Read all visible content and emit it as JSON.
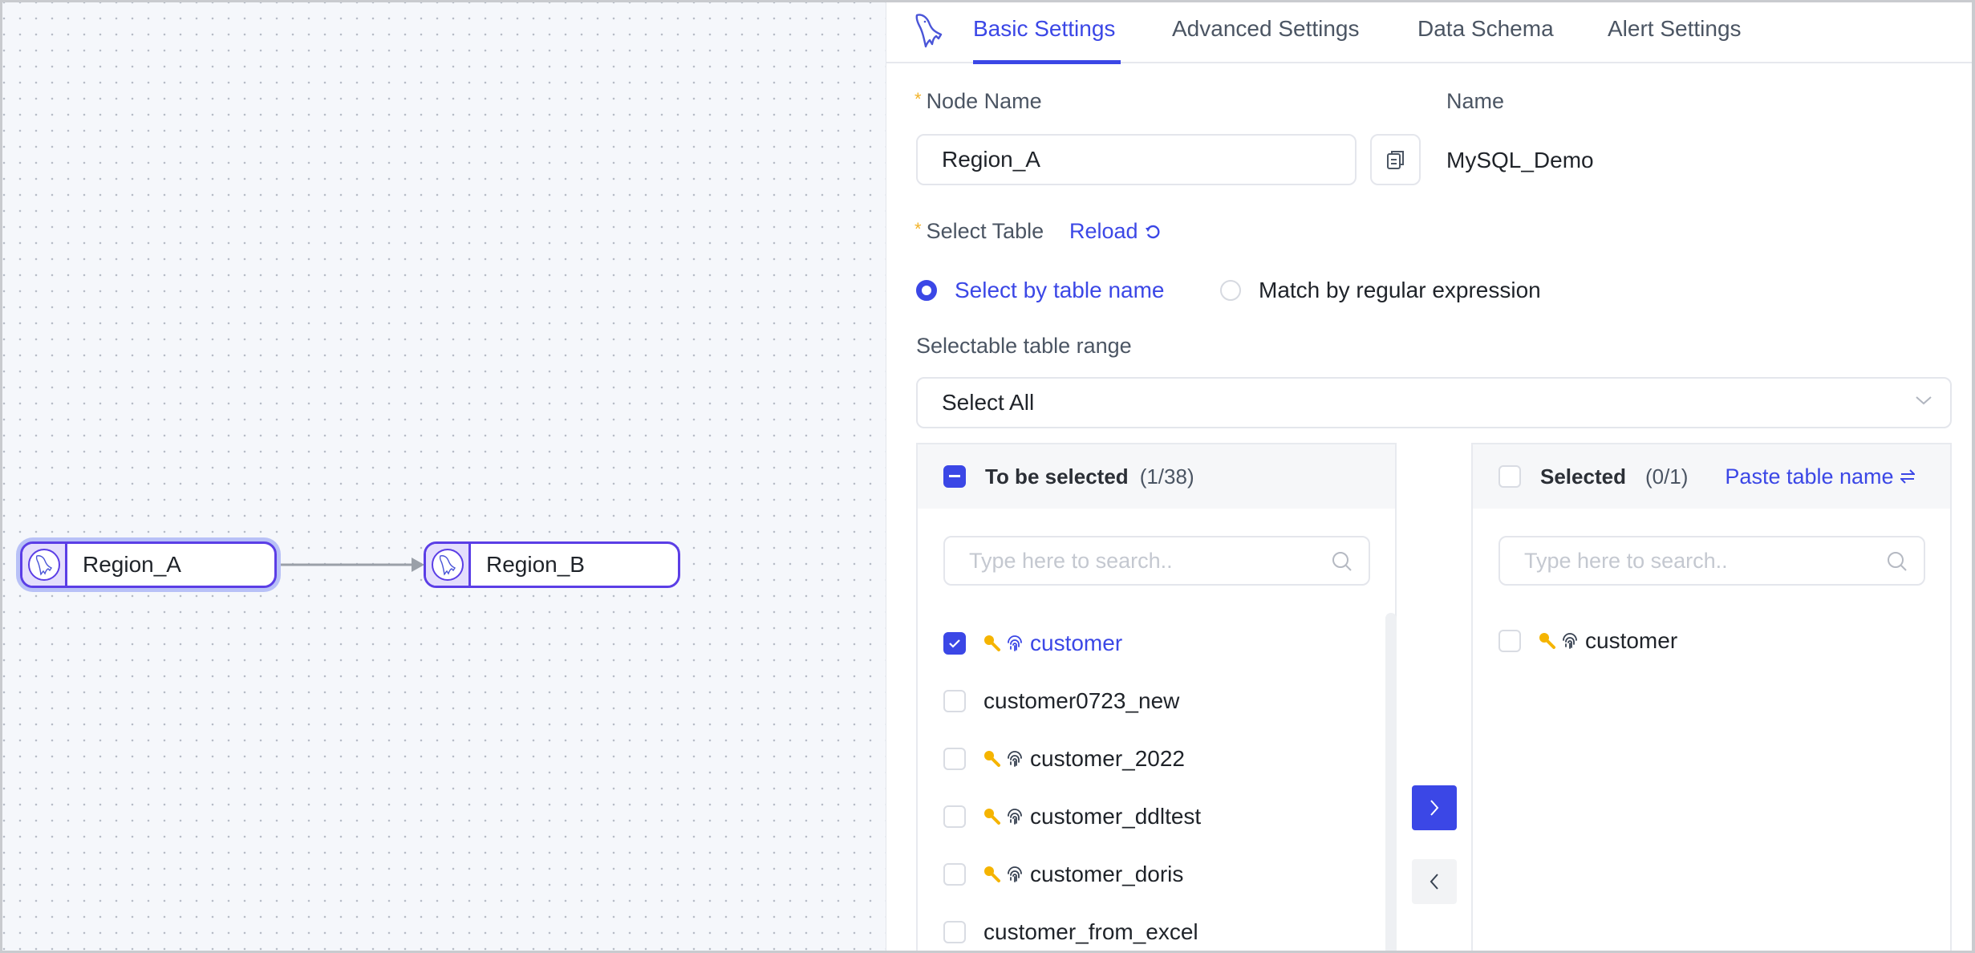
{
  "canvas": {
    "nodes": [
      {
        "label": "Region_A",
        "icon": "mysql-dolphin-icon",
        "selected": true
      },
      {
        "label": "Region_B",
        "icon": "mysql-dolphin-icon",
        "selected": false
      }
    ],
    "edges": [
      {
        "from": "Region_A",
        "to": "Region_B"
      }
    ]
  },
  "panel": {
    "logo_icon": "mysql-dolphin-icon",
    "tabs": [
      {
        "label": "Basic Settings",
        "active": true
      },
      {
        "label": "Advanced Settings",
        "active": false
      },
      {
        "label": "Data Schema",
        "active": false
      },
      {
        "label": "Alert Settings",
        "active": false
      }
    ],
    "node_name": {
      "label": "Node Name",
      "required_mark": "*",
      "value": "Region_A",
      "copy_icon": "copy-icon"
    },
    "connection_name": {
      "label": "Name",
      "value": "MySQL_Demo"
    },
    "select_table": {
      "label": "Select Table",
      "required_mark": "*",
      "reload_label": "Reload",
      "reload_icon": "refresh-icon"
    },
    "selection_mode": {
      "options": [
        {
          "label": "Select by table name",
          "checked": true
        },
        {
          "label": "Match by regular expression",
          "checked": false
        }
      ]
    },
    "table_range": {
      "label": "Selectable table range",
      "value": "Select All"
    },
    "transfer": {
      "source": {
        "title": "To be selected",
        "count": "(1/38)",
        "header_checkbox": "indeterminate",
        "search_placeholder": "Type here to search..",
        "items": [
          {
            "label": "customer",
            "checked": true,
            "has_primary_key": true,
            "has_index": true
          },
          {
            "label": "customer0723_new",
            "checked": false,
            "has_primary_key": false,
            "has_index": false
          },
          {
            "label": "customer_2022",
            "checked": false,
            "has_primary_key": true,
            "has_index": true
          },
          {
            "label": "customer_ddltest",
            "checked": false,
            "has_primary_key": true,
            "has_index": true
          },
          {
            "label": "customer_doris",
            "checked": false,
            "has_primary_key": true,
            "has_index": true
          },
          {
            "label": "customer_from_excel",
            "checked": false,
            "has_primary_key": false,
            "has_index": false
          }
        ]
      },
      "target": {
        "title": "Selected",
        "count": "(0/1)",
        "header_checkbox": "unchecked",
        "paste_label": "Paste table name",
        "paste_icon": "swap-icon",
        "search_placeholder": "Type here to search..",
        "items": [
          {
            "label": "customer",
            "checked": false,
            "has_primary_key": true,
            "has_index": true
          }
        ]
      },
      "move_right_icon": "chevron-right-icon",
      "move_left_icon": "chevron-left-icon"
    }
  },
  "colors": {
    "accent": "#3b47e6",
    "node_border": "#5b3ee6",
    "key_icon": "#f5b400",
    "canvas_bg": "#f5f7fb"
  }
}
